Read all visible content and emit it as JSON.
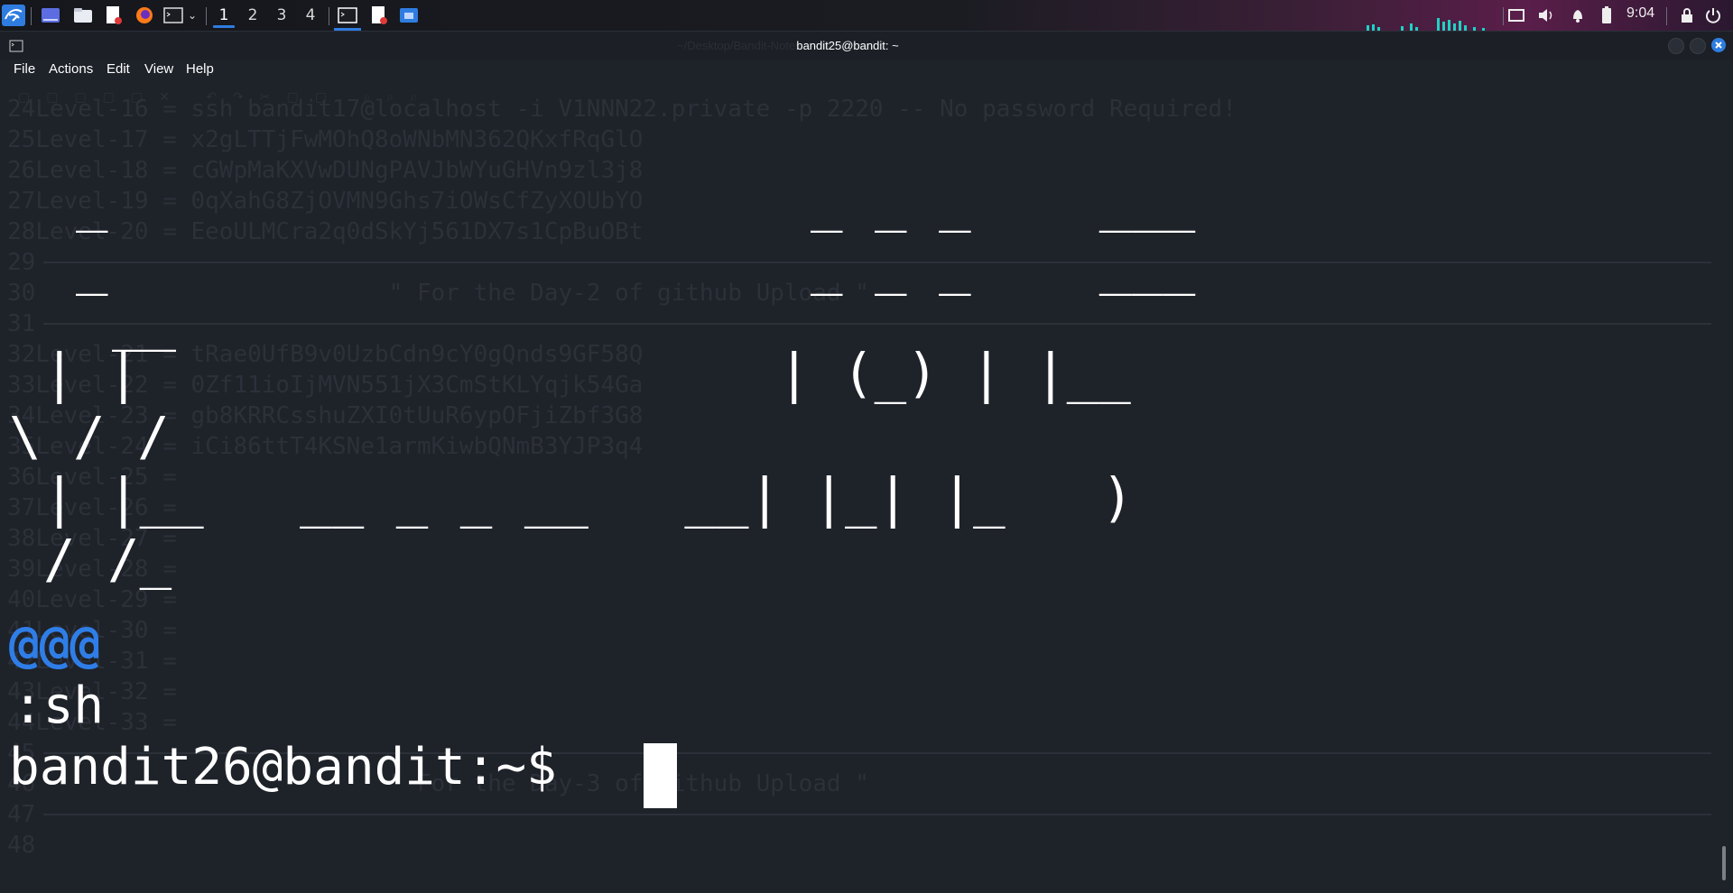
{
  "panel": {
    "workspaces": [
      "1",
      "2",
      "3",
      "4"
    ],
    "active_workspace": "1",
    "clock": "9:04",
    "icons": [
      "kali-menu-icon",
      "show-desktop-icon",
      "file-manager-icon",
      "text-editor-icon",
      "firefox-icon",
      "terminal-icon",
      "chevron-down-icon",
      "terminal-window-icon",
      "editor-window-icon",
      "files-window-icon",
      "display-icon",
      "volume-icon",
      "bell-icon",
      "battery-icon",
      "lock-icon",
      "power-icon"
    ],
    "accent": "#2f7ce0"
  },
  "window": {
    "title": "bandit25@bandit: ~",
    "background_title": "~/Desktop/Bandit-Notes — Mousepad"
  },
  "menu": [
    "File",
    "Actions",
    "Edit",
    "View",
    "Help"
  ],
  "ghost": {
    "lines": [
      {
        "n": "24",
        "text": "Level-16 = ssh bandit17@localhost -i V1NNN22.private -p 2220 -- No password Required!"
      },
      {
        "n": "25",
        "text": "Level-17 = x2gLTTjFwMOhQ8oWNbMN362QKxfRqGlO"
      },
      {
        "n": "26",
        "text": "Level-18 = cGWpMaKXVwDUNgPAVJbWYuGHVn9zl3j8"
      },
      {
        "n": "27",
        "text": "Level-19 = 0qXahG8ZjOVMN9Ghs7iOWsCfZyXOUbYO"
      },
      {
        "n": "28",
        "text": "Level-20 = EeoULMCra2q0dSkYj561DX7s1CpBuOBt"
      },
      {
        "n": "29",
        "text": ""
      },
      {
        "n": "30",
        "text": "                         \" For the Day-2 of github Upload \""
      },
      {
        "n": "31",
        "text": ""
      },
      {
        "n": "32",
        "text": "Level-21 = tRae0UfB9v0UzbCdn9cY0gQnds9GF58Q"
      },
      {
        "n": "33",
        "text": "Level-22 = 0Zf11ioIjMVN551jX3CmStKLYqjk54Ga"
      },
      {
        "n": "34",
        "text": "Level-23 = gb8KRRCsshuZXI0tUuR6ypOFjiZbf3G8"
      },
      {
        "n": "35",
        "text": "Level-24 = iCi86ttT4KSNe1armKiwbQNmB3YJP3q4"
      },
      {
        "n": "36",
        "text": "Level-25 ="
      },
      {
        "n": "37",
        "text": "Level-26 ="
      },
      {
        "n": "38",
        "text": "Level-27 ="
      },
      {
        "n": "39",
        "text": "Level-28 ="
      },
      {
        "n": "40",
        "text": "Level-29 ="
      },
      {
        "n": "41",
        "text": "Level-30 ="
      },
      {
        "n": "42",
        "text": "Level-31 ="
      },
      {
        "n": "43",
        "text": "Level-32 ="
      },
      {
        "n": "44",
        "text": "Level-33 ="
      },
      {
        "n": "45",
        "text": ""
      },
      {
        "n": "46",
        "text": "                         \" For the Day-3 of github Upload \""
      },
      {
        "n": "47",
        "text": ""
      },
      {
        "n": "48",
        "text": ""
      }
    ],
    "separator_color": "#2c3039"
  },
  "terminal": {
    "art": [
      {
        "text": "_",
        "name": "art-fragment-1"
      },
      {
        "text": "_ _ _    ___",
        "name": "art-fragment-2"
      },
      {
        "text": "_",
        "name": "art-fragment-3"
      },
      {
        "text": "_ _ _    ___",
        "name": "art-fragment-4"
      },
      {
        "text": "__",
        "name": "art-fragment-5"
      },
      {
        "text": "| |",
        "name": "art-fragment-6"
      },
      {
        "text": "| (_) | |__",
        "name": "art-fragment-7"
      },
      {
        "text": "\\ / /",
        "name": "art-fragment-8"
      },
      {
        "text": "| |__   __ _ _ __   __| |_| |_   )",
        "name": "art-fragment-9"
      },
      {
        "text": "/ /_",
        "name": "art-fragment-10"
      }
    ],
    "at_signs": "@@@",
    "sh": ":sh",
    "prompt": "bandit26@bandit:~$ ",
    "prompt_color": "#ffffff",
    "at_color": "#2f7ee8",
    "cursor": "█"
  }
}
